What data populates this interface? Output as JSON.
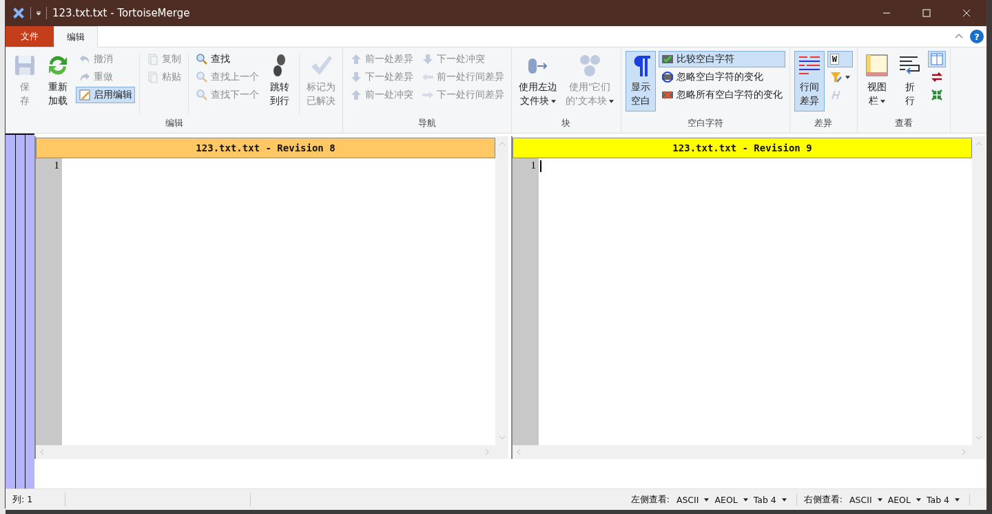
{
  "window": {
    "title": "123.txt.txt - TortoiseMerge"
  },
  "ribbon": {
    "tabs": [
      {
        "label": "文件",
        "kind": "file",
        "selected": false
      },
      {
        "label": "编辑",
        "kind": "tab",
        "selected": true
      }
    ],
    "help_button": "?",
    "groups": [
      {
        "label": "编辑",
        "sections": [
          [
            {
              "kind": "large",
              "lines": [
                "保",
                "存"
              ],
              "disabled": true,
              "selected": false
            },
            {
              "kind": "large",
              "lines": [
                "重新",
                "加载"
              ],
              "disabled": false,
              "selected": false
            },
            {
              "kind": "stack",
              "items": [
                {
                  "kind": "text",
                  "label": "撤消",
                  "disabled": true,
                  "selected": false
                },
                {
                  "kind": "text",
                  "label": "重做",
                  "disabled": true,
                  "selected": false
                },
                {
                  "kind": "text",
                  "label": "启用编辑",
                  "disabled": false,
                  "selected": true
                }
              ]
            }
          ],
          [
            {
              "kind": "stack",
              "items": [
                {
                  "kind": "text",
                  "label": "复制",
                  "disabled": true,
                  "selected": false
                },
                {
                  "kind": "text",
                  "label": "粘贴",
                  "disabled": true,
                  "selected": false
                }
              ]
            }
          ],
          [
            {
              "kind": "stack",
              "items": [
                {
                  "kind": "text",
                  "label": "查找",
                  "disabled": false,
                  "selected": false
                },
                {
                  "kind": "text",
                  "label": "查找上一个",
                  "disabled": true,
                  "selected": false
                },
                {
                  "kind": "text",
                  "label": "查找下一个",
                  "disabled": true,
                  "selected": false
                }
              ]
            },
            {
              "kind": "large",
              "lines": [
                "跳转",
                "到行"
              ],
              "disabled": false,
              "selected": false
            }
          ],
          [
            {
              "kind": "large",
              "lines": [
                "标记为",
                "已解决"
              ],
              "disabled": true,
              "selected": false
            }
          ]
        ]
      },
      {
        "label": "导航",
        "sections": [
          [
            {
              "kind": "stack",
              "items": [
                {
                  "kind": "text",
                  "label": "前一处差异",
                  "disabled": true,
                  "selected": false
                },
                {
                  "kind": "text",
                  "label": "下一处差异",
                  "disabled": true,
                  "selected": false
                },
                {
                  "kind": "text",
                  "label": "前一处冲突",
                  "disabled": true,
                  "selected": false
                }
              ]
            },
            {
              "kind": "stack",
              "items": [
                {
                  "kind": "text",
                  "label": "下一处冲突",
                  "disabled": true,
                  "selected": false
                },
                {
                  "kind": "text",
                  "label": "前一处行间差异",
                  "disabled": true,
                  "selected": false
                },
                {
                  "kind": "text",
                  "label": "下一处行间差异",
                  "disabled": true,
                  "selected": false
                }
              ]
            }
          ]
        ]
      },
      {
        "label": "块",
        "sections": [
          [
            {
              "kind": "large",
              "lines": [
                "使用左边",
                "文件块"
              ],
              "dropdown": true,
              "disabled": false,
              "selected": false
            },
            {
              "kind": "large",
              "lines": [
                "使用'它们",
                "的'文本块"
              ],
              "dropdown": true,
              "disabled": true,
              "selected": false
            }
          ]
        ]
      },
      {
        "label": "空白字符",
        "sections": [
          [
            {
              "kind": "large",
              "lines": [
                "显示",
                "空白"
              ],
              "disabled": false,
              "selected": true
            },
            {
              "kind": "stack",
              "items": [
                {
                  "kind": "text",
                  "label": "比较空白字符",
                  "disabled": false,
                  "selected": true
                },
                {
                  "kind": "text",
                  "label": "忽略空白字符的变化",
                  "disabled": false,
                  "selected": false
                },
                {
                  "kind": "text",
                  "label": "忽略所有空白字符的变化",
                  "disabled": false,
                  "selected": false
                }
              ]
            }
          ]
        ]
      },
      {
        "label": "差异",
        "sections": [
          [
            {
              "kind": "large",
              "lines": [
                "行间",
                "差异"
              ],
              "disabled": false,
              "selected": true
            },
            {
              "kind": "stack",
              "items": [
                {
                  "kind": "glyph",
                  "label": "W",
                  "disabled": false,
                  "selected": true
                },
                {
                  "kind": "icon",
                  "dropdown": true,
                  "disabled": false,
                  "selected": false
                },
                {
                  "kind": "icon",
                  "disabled": true,
                  "selected": false
                }
              ]
            }
          ]
        ]
      },
      {
        "label": "查看",
        "sections": [
          [
            {
              "kind": "large",
              "lines": [
                "视图",
                "栏"
              ],
              "dropdown": true,
              "disabled": false,
              "selected": false
            },
            {
              "kind": "large",
              "lines": [
                "折",
                "行"
              ],
              "disabled": false,
              "selected": false
            },
            {
              "kind": "stack",
              "items": [
                {
                  "kind": "icon",
                  "disabled": false,
                  "selected": true
                },
                {
                  "kind": "icon",
                  "disabled": false,
                  "selected": false
                },
                {
                  "kind": "icon",
                  "disabled": false,
                  "selected": false
                }
              ]
            }
          ]
        ]
      }
    ]
  },
  "panes": [
    {
      "header": "123.txt.txt - Revision 8",
      "color": "#ffc864",
      "line_numbers": [
        "1"
      ]
    },
    {
      "header": "123.txt.txt - Revision 9",
      "color": "#ffff00",
      "line_numbers": [
        "1"
      ],
      "cursor": true
    }
  ],
  "status_bar": {
    "column": "列: 1",
    "views": [
      {
        "label": "左侧查看:",
        "encoding": "ASCII",
        "eol": "AEOL",
        "tab": "Tab 4"
      },
      {
        "label": "右侧查看:",
        "encoding": "ASCII",
        "eol": "AEOL",
        "tab": "Tab 4"
      }
    ]
  }
}
